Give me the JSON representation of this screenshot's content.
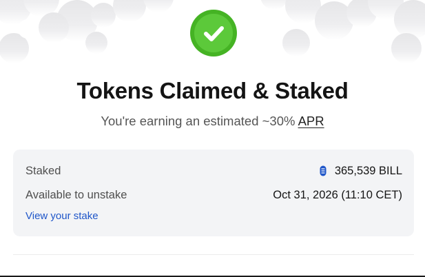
{
  "colors": {
    "success_green": "#5cc93a",
    "link_blue": "#1f56c9",
    "card_bg": "#f3f4f6",
    "token_blue": "#1f56c9"
  },
  "header": {
    "success_icon": "checkmark-icon",
    "title": "Tokens Claimed & Staked",
    "subtitle_prefix": "You're earning an estimated ~30% ",
    "apr_link": "APR"
  },
  "card": {
    "staked_label": "Staked",
    "staked_token_icon": "bill-token-icon",
    "staked_value": "365,539 BILL",
    "unstake_label": "Available to unstake",
    "unstake_value": "Oct 31, 2026 (11:10 CET)",
    "view_stake_link": "View your stake"
  }
}
